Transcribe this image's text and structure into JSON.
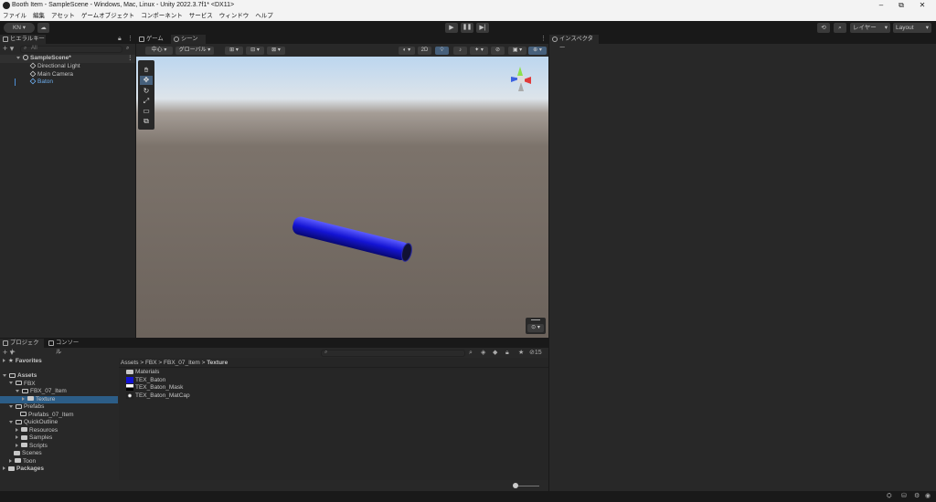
{
  "window": {
    "title": "Booth Item - SampleScene - Windows, Mac, Linux - Unity 2022.3.7f1* <DX11>",
    "minimize": "–",
    "restore": "⧉",
    "close": "✕"
  },
  "menu": [
    "ファイル",
    "編集",
    "アセット",
    "ゲームオブジェクト",
    "コンポーネント",
    "サービス",
    "ウィンドウ",
    "ヘルプ"
  ],
  "toolbar": {
    "account": "KN ▾",
    "layers": "レイヤー",
    "layout": "Layout"
  },
  "hierarchy": {
    "tab": "ヒエラルキー",
    "add": "+ ▾",
    "search_placeholder": "All",
    "items": [
      {
        "label": "SampleScene*"
      },
      {
        "label": "Directional Light"
      },
      {
        "label": "Main Camera"
      },
      {
        "label": "Baton"
      }
    ]
  },
  "tabs": {
    "game": "ゲーム",
    "scene": "シーン",
    "inspector": "インスペクター",
    "project": "プロジェクト",
    "console": "コンソール"
  },
  "scene_toolbar": {
    "pivot": "中心",
    "space": "グローバル",
    "mode_2d": "2D"
  },
  "project": {
    "add": "+ ▾",
    "hidden_count": "15",
    "favorites": "Favorites",
    "tree": [
      {
        "label": "Assets"
      },
      {
        "label": "FBX"
      },
      {
        "label": "FBX_07_Item"
      },
      {
        "label": "Texture"
      },
      {
        "label": "Prefabs"
      },
      {
        "label": "Prefabs_07_Item"
      },
      {
        "label": "QuickOutline"
      },
      {
        "label": "Resources"
      },
      {
        "label": "Samples"
      },
      {
        "label": "Scripts"
      },
      {
        "label": "Scenes"
      },
      {
        "label": "Toon"
      },
      {
        "label": "Packages"
      }
    ],
    "breadcrumb": [
      "Assets",
      "FBX",
      "FBX_07_Item",
      "Texture"
    ],
    "files": [
      {
        "label": "Materials",
        "kind": "folder"
      },
      {
        "label": "TEX_Baton",
        "kind": "texture-blue"
      },
      {
        "label": "TEX_Baton_Mask",
        "kind": "texture-mask"
      },
      {
        "label": "TEX_Baton_MatCap",
        "kind": "texture-matcap"
      }
    ]
  },
  "colors": {
    "baton": "#1414d4",
    "selection": "#2c5d87",
    "accent": "#4d8fd6"
  }
}
